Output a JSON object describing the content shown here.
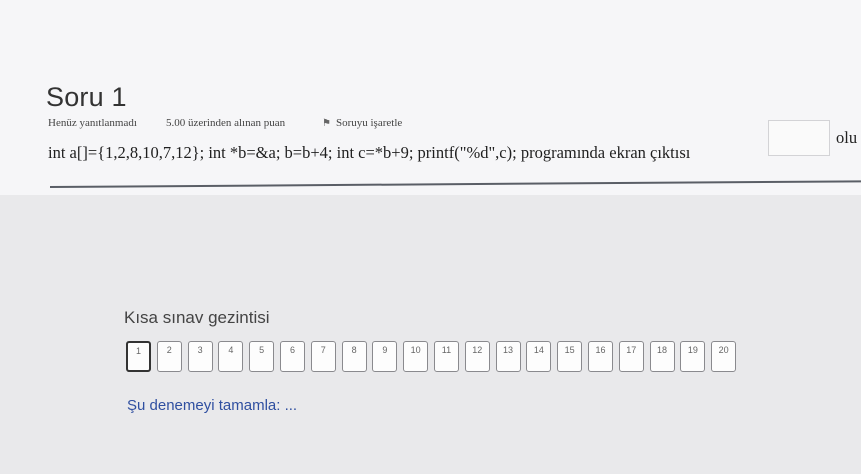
{
  "question": {
    "title": "Soru 1",
    "status": "Henüz yanıtlanmadı",
    "points": "5.00 üzerinden alınan puan",
    "flag_label": "Soruyu işaretle",
    "text": "int a[]={1,2,8,10,7,12}; int *b=&a; b=b+4; int c=*b+9; printf(\"%d\",c); programında ekran çıktısı",
    "answer_value": "",
    "after_text": "olu"
  },
  "navigation": {
    "title": "Kısa sınav gezintisi",
    "buttons": [
      "1",
      "2",
      "3",
      "4",
      "5",
      "6",
      "7",
      "8",
      "9",
      "10",
      "11",
      "12",
      "13",
      "14",
      "15",
      "16",
      "17",
      "18",
      "19",
      "20"
    ],
    "current": "1",
    "finish_link": "Şu denemeyi tamamla: ..."
  }
}
